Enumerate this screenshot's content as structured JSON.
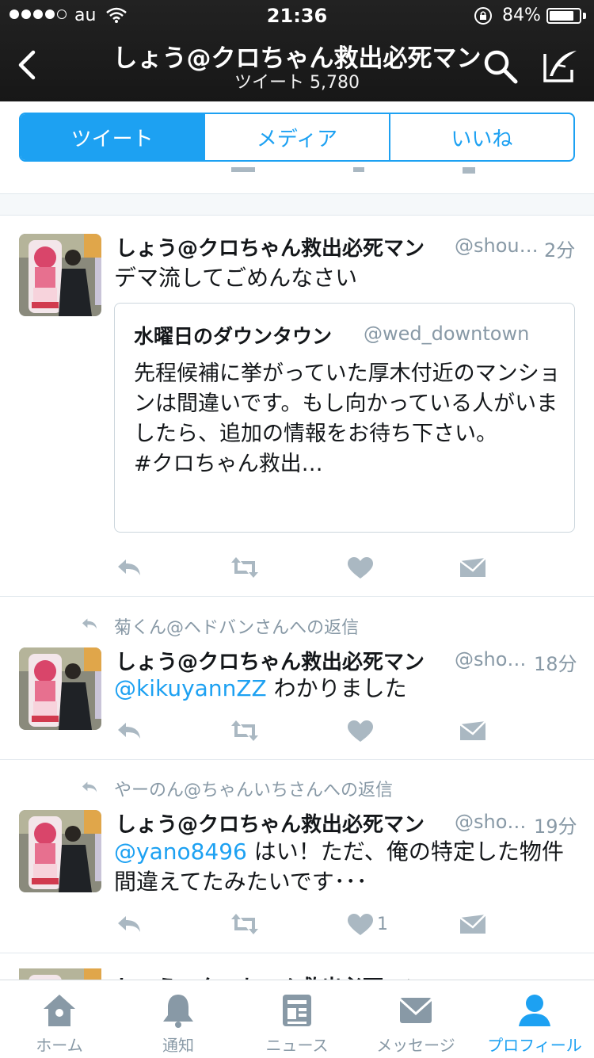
{
  "status_bar": {
    "carrier": "au",
    "time": "21:36",
    "battery": "84%",
    "battery_level": 0.84
  },
  "nav": {
    "title": "しょう@クロちゃん救出必死マン",
    "subtitle": "ツイート 5,780"
  },
  "segments": [
    {
      "label": "ツイート",
      "active": true
    },
    {
      "label": "メディア",
      "active": false
    },
    {
      "label": "いいね",
      "active": false
    }
  ],
  "tweets": [
    {
      "name": "しょう@クロちゃん救出必死マン",
      "handle": "@shou…",
      "time": "2分",
      "text": "デマ流してごめんなさい",
      "quote": {
        "name": "水曜日のダウンタウン",
        "handle": "@wed_downtown",
        "text": "先程候補に挙がっていた厚木付近のマンションは間違いです。もし向かっている人がいましたら、追加の情報をお待ち下さい。\n#クロちゃん救出…"
      }
    },
    {
      "reply_context": "菊くん@ヘドバンさんへの返信",
      "name": "しょう@クロちゃん救出必死マン",
      "handle": "@sho…",
      "time": "18分",
      "mention": "@kikuyannZZ",
      "text": " わかりました"
    },
    {
      "reply_context": "やーのん@ちゃんいちさんへの返信",
      "name": "しょう@クロちゃん救出必死マン",
      "handle": "@sho…",
      "time": "19分",
      "mention": "@yano8496",
      "text": " はい！ただ、俺の特定した物件間違えてたみたいです･･･",
      "likes": "1"
    }
  ],
  "tab_bar": [
    {
      "label": "ホーム",
      "icon": "home-icon"
    },
    {
      "label": "通知",
      "icon": "bell-icon"
    },
    {
      "label": "ニュース",
      "icon": "news-icon"
    },
    {
      "label": "メッセージ",
      "icon": "envelope-icon"
    },
    {
      "label": "プロフィール",
      "icon": "profile-icon",
      "active": true
    }
  ],
  "colors": {
    "accent": "#1da1f2",
    "secondary_text": "#8899a6",
    "header_bg": "#1b1b1b"
  }
}
